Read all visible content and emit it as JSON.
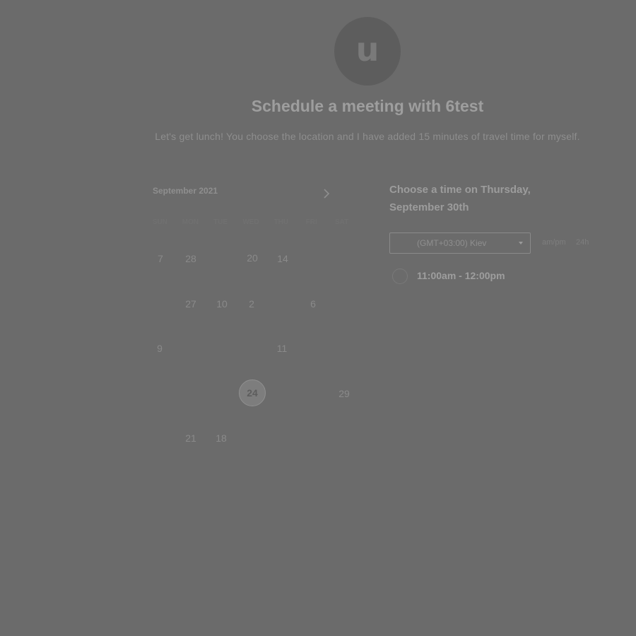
{
  "host": {
    "avatar_letter": "u",
    "title": "Schedule a meeting with 6test",
    "description": "Let's get lunch! You choose the location and I have added 15 minutes of travel time for myself."
  },
  "calendar": {
    "month_label": "September 2021",
    "next_icon": "chevron-right-icon",
    "weekdays": [
      "SUN",
      "MON",
      "TUE",
      "WED",
      "THU",
      "FRI",
      "SAT"
    ],
    "days": [
      {
        "label": "7"
      },
      {
        "label": "28"
      },
      {
        "label": "20"
      },
      {
        "label": "14"
      },
      {
        "label": "27"
      },
      {
        "label": "10"
      },
      {
        "label": "2"
      },
      {
        "label": "6"
      },
      {
        "label": "9"
      },
      {
        "label": "11"
      },
      {
        "label": "24"
      },
      {
        "label": "29"
      },
      {
        "label": "21"
      },
      {
        "label": "18"
      }
    ],
    "selected_day": "24"
  },
  "times": {
    "heading": "Choose a time on Thursday, September 30th",
    "timezone": "(GMT+03:00) Kiev",
    "format_ampm": "am/pm",
    "format_24h": "24h",
    "slots": [
      {
        "label": "11:00am - 12:00pm"
      }
    ]
  }
}
